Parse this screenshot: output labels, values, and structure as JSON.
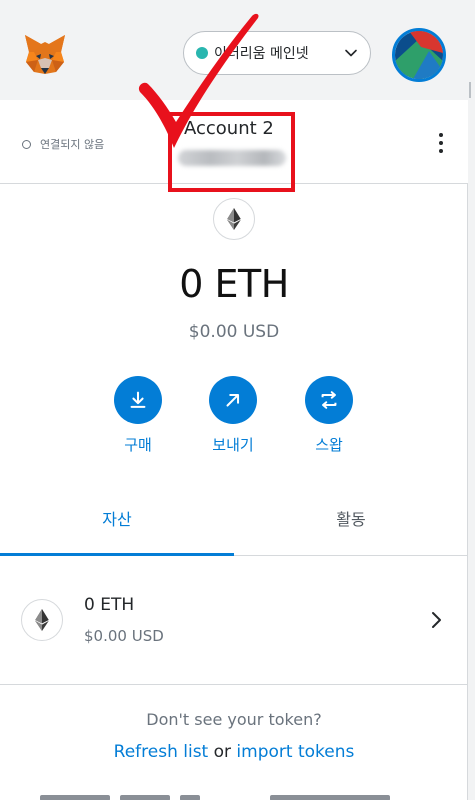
{
  "header": {
    "logo_icon": "metamask-fox-icon",
    "network": {
      "label": "이더리움 메인넷",
      "dot_color": "#29b6af"
    },
    "avatar_icon": "account-identicon"
  },
  "account": {
    "connection_status": "연결되지 않음",
    "name": "Account 2",
    "address": ""
  },
  "annotation": {
    "highlight_color": "#e8111c"
  },
  "balance": {
    "amount": "0 ETH",
    "fiat": "$0.00 USD"
  },
  "actions": [
    {
      "label": "구매",
      "icon": "download-icon"
    },
    {
      "label": "보내기",
      "icon": "send-arrow-icon"
    },
    {
      "label": "스왑",
      "icon": "swap-icon"
    }
  ],
  "tabs": [
    {
      "label": "자산",
      "active": true
    },
    {
      "label": "활동",
      "active": false
    }
  ],
  "assets": [
    {
      "amount": "0 ETH",
      "fiat": "$0.00 USD",
      "icon": "ethereum-icon"
    }
  ],
  "footer": {
    "hint": "Don't see your token?",
    "refresh_link": "Refresh list",
    "or": "or",
    "import_link": "import tokens"
  },
  "colors": {
    "accent": "#037dd6",
    "header_bg": "#f2f3f4"
  }
}
